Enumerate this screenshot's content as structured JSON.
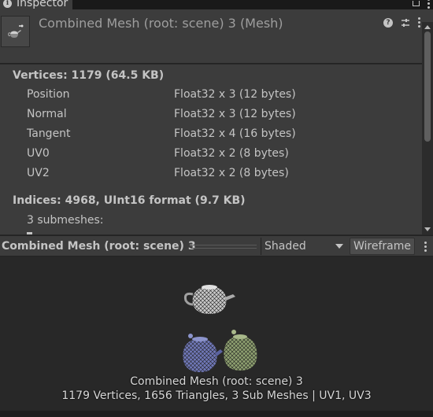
{
  "window": {
    "tab_title": "Inspector"
  },
  "header": {
    "title": "Combined Mesh (root: scene) 3 (Mesh)"
  },
  "mesh_info": {
    "vertices_title": "Vertices: 1179 (64.5 KB)",
    "attributes": [
      {
        "name": "Position",
        "format": "Float32 x 3 (12 bytes)"
      },
      {
        "name": "Normal",
        "format": "Float32 x 3 (12 bytes)"
      },
      {
        "name": "Tangent",
        "format": "Float32 x 4 (16 bytes)"
      },
      {
        "name": "UV0",
        "format": "Float32 x 2 (8 bytes)"
      },
      {
        "name": "UV2",
        "format": "Float32 x 2 (8 bytes)"
      }
    ],
    "indices_title": "Indices: 4968, UInt16 format (9.7 KB)",
    "submeshes_label": "3 submeshes:"
  },
  "preview": {
    "title": "Combined Mesh (root: scene) 3",
    "shading_value": "Shaded",
    "wireframe_label": "Wireframe",
    "mesh_name": "Combined Mesh (root: scene) 3",
    "stats": "1179 Vertices, 1656 Triangles, 3 Sub Meshes | UV1, UV3"
  },
  "colors": {
    "teapot_white": "#c8c8c8",
    "teapot_blue": "#7078b8",
    "teapot_green": "#8ea070"
  },
  "icons": [
    "info-icon",
    "lock-icon",
    "kebab-menu-icon",
    "help-icon",
    "preset-icon",
    "dropdown-icon",
    "mesh-icon"
  ]
}
